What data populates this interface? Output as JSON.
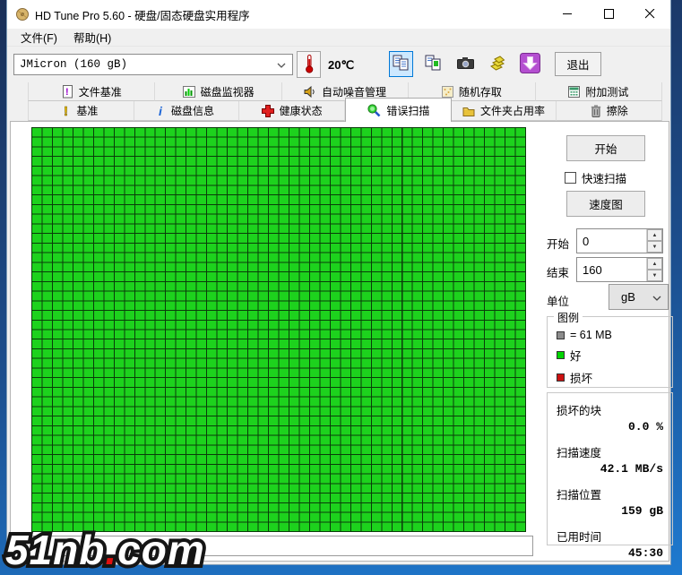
{
  "window": {
    "title": "HD Tune Pro 5.60 - 硬盘/固态硬盘实用程序"
  },
  "menu": {
    "items": [
      {
        "label": "文件(F)"
      },
      {
        "label": "帮助(H)"
      }
    ]
  },
  "toolbar": {
    "drive_select_value": "JMicron  (160 gB)",
    "temperature": "20℃",
    "exit_label": "退出",
    "icons": [
      "thermometer-icon",
      "copy-text-icon",
      "copy-image-icon",
      "camera-icon",
      "save-icon",
      "update-icon"
    ]
  },
  "tabs": {
    "row1": [
      {
        "label": "文件基准",
        "icon": "file-benchmark-icon"
      },
      {
        "label": "磁盘监视器",
        "icon": "disk-monitor-icon"
      },
      {
        "label": "自动噪音管理",
        "icon": "aam-icon"
      },
      {
        "label": "随机存取",
        "icon": "random-access-icon"
      },
      {
        "label": "附加测试",
        "icon": "extra-tests-icon"
      }
    ],
    "row2": [
      {
        "label": "基准",
        "icon": "benchmark-icon"
      },
      {
        "label": "磁盘信息",
        "icon": "disk-info-icon"
      },
      {
        "label": "健康状态",
        "icon": "health-icon"
      },
      {
        "label": "错误扫描",
        "icon": "error-scan-icon",
        "active": true
      },
      {
        "label": "文件夹占用率",
        "icon": "folder-usage-icon"
      },
      {
        "label": "擦除",
        "icon": "erase-icon"
      }
    ]
  },
  "scan": {
    "start_button": "开始",
    "quick_scan_label": "快速扫描",
    "quick_scan_checked": false,
    "speed_map_button": "速度图",
    "start_label": "开始",
    "start_value": "0",
    "end_label": "结束",
    "end_value": "160",
    "unit_label": "单位",
    "unit_value": "gB",
    "legend": {
      "title": "图例",
      "block_size": "= 61 MB",
      "block_swatch_color": "#8c8c8c",
      "good_label": "好",
      "good_color": "#00d400",
      "bad_label": "损坏",
      "bad_color": "#cc1111"
    },
    "stats": [
      {
        "label": "损坏的块",
        "value": "0.0 %"
      },
      {
        "label": "扫描速度",
        "value": "42.1 MB/s"
      },
      {
        "label": "扫描位置",
        "value": "159 gB"
      },
      {
        "label": "已用时间",
        "value": "45:30"
      }
    ],
    "grid": {
      "columns": 48,
      "rows": 42,
      "cell_color": "#1dd21d",
      "line_color": "#0a3c0a",
      "all_blocks_status": "good"
    }
  },
  "watermark": {
    "left": "51nb",
    "dot": ".",
    "right": "com"
  }
}
